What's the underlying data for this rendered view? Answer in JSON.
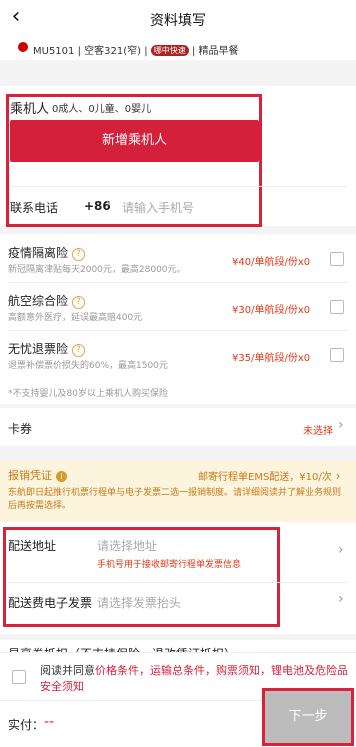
{
  "header": {
    "title": "资料填写",
    "back_icon": "back-chevron"
  },
  "flight": {
    "info_pre": "MU5101 | 空客321(窄) |",
    "badge": "哪中快速",
    "info_post": "| 精品早餐"
  },
  "passenger": {
    "label": "乘机人",
    "counts": "0成人、0儿童、0婴儿",
    "add_button": "新增乘机人"
  },
  "contact": {
    "label": "联系电话",
    "country_code": "+86",
    "phone_placeholder": "请输入手机号"
  },
  "insurance": [
    {
      "title": "疫情隔离险",
      "desc": "新冠隔离津贴每天2000元，最高28000元。",
      "price": "¥40/单航段/份x0"
    },
    {
      "title": "航空综合险",
      "desc": "高额意外医疗，延误最高赔400元",
      "price": "¥30/单航段/份x0"
    },
    {
      "title": "无忧退票险",
      "desc": "退票补偿票价损失的60%，最高1500元",
      "price": "¥35/单航段/份x0"
    }
  ],
  "insurance_note": "*不支持婴儿及80岁以上乘机人购买保险",
  "coupon": {
    "label": "卡券",
    "value": "未选择"
  },
  "reimburse": {
    "label": "报销凭证",
    "option": "邮寄行程单EMS配送，¥10/次",
    "desc": "东航即日起推行机票行程单与电子发票二选一报销制度。请详细阅读并了解业务规则后再按需选择。"
  },
  "delivery": {
    "address_label": "配送地址",
    "address_placeholder": "请选择地址",
    "address_hint": "手机号用于接收邮寄行程单发票信息",
    "invoice_label": "配送费电子发票",
    "invoice_placeholder": "请选择发票抬头"
  },
  "partial_row": "易享券抵扣（不支持保险，退改凭证抵扣）",
  "agreement": {
    "prefix": "阅读并同意",
    "links": "价格条件，运输总条件，购票须知，锂电池及危险品安全须知"
  },
  "footer": {
    "pay_label": "实付：",
    "pay_value": "--",
    "next_button": "下一步"
  },
  "colors": {
    "accent": "#d4203a",
    "price": "#e0391a",
    "reimburse_bg": "#fdf4dd"
  }
}
